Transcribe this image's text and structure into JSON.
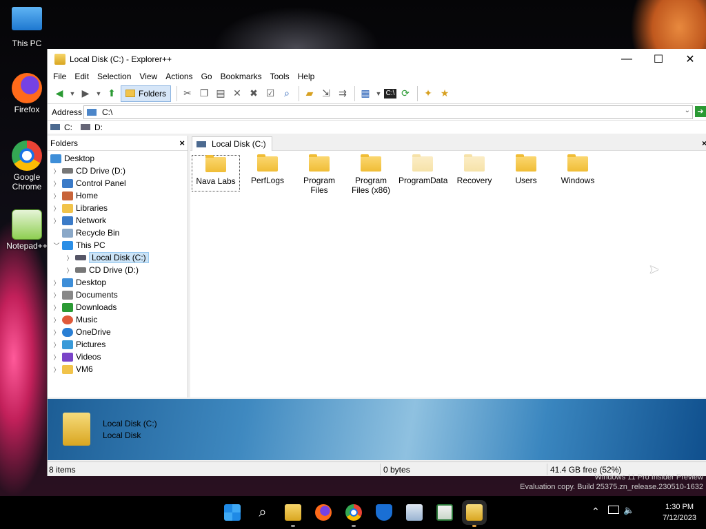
{
  "desktop": {
    "icons": [
      {
        "label": "This PC",
        "color": "#1e90e0"
      },
      {
        "label": "Firefox",
        "color": "#ff6a1a"
      },
      {
        "label": "Google Chrome",
        "color": "#2f9a3c"
      },
      {
        "label": "Notepad++",
        "color": "#7bc043"
      }
    ]
  },
  "window": {
    "title": "Local Disk (C:) - Explorer++",
    "minimize_label": "—",
    "maximize_label": "☐",
    "close_label": "✕"
  },
  "menu": [
    "File",
    "Edit",
    "Selection",
    "View",
    "Actions",
    "Go",
    "Bookmarks",
    "Tools",
    "Help"
  ],
  "toolbar": {
    "folders_label": "Folders"
  },
  "address": {
    "label": "Address",
    "value": "C:\\",
    "go_label": "➔"
  },
  "drives": [
    {
      "label": "C:"
    },
    {
      "label": "D:"
    }
  ],
  "tree": {
    "header": "Folders",
    "close_label": "×",
    "items": [
      {
        "label": "Desktop",
        "color": "#3e8ed8"
      },
      {
        "label": "CD Drive (D:)",
        "color": "#777"
      },
      {
        "label": "Control Panel",
        "color": "#3b7bc8"
      },
      {
        "label": "Home",
        "color": "#c8643a"
      },
      {
        "label": "Libraries",
        "color": "#f1c34a"
      },
      {
        "label": "Network",
        "color": "#3b7bc8"
      },
      {
        "label": "Recycle Bin",
        "color": "#8aa8c8"
      },
      {
        "label": "This PC",
        "color": "#2a8ee6"
      },
      {
        "label": "Local Disk (C:)",
        "color": "#556"
      },
      {
        "label": "CD Drive (D:)",
        "color": "#777"
      },
      {
        "label": "Desktop",
        "color": "#3e8ed8"
      },
      {
        "label": "Documents",
        "color": "#888"
      },
      {
        "label": "Downloads",
        "color": "#2b9a34"
      },
      {
        "label": "Music",
        "color": "#e05a3a"
      },
      {
        "label": "OneDrive",
        "color": "#2a7fd4"
      },
      {
        "label": "Pictures",
        "color": "#3a9ad8"
      },
      {
        "label": "Videos",
        "color": "#7a44c8"
      },
      {
        "label": "VM6",
        "color": "#f1c34a"
      }
    ]
  },
  "tab": {
    "label": "Local Disk (C:)",
    "close_label": "×"
  },
  "files": [
    {
      "name": "Nava Labs"
    },
    {
      "name": "PerfLogs"
    },
    {
      "name": "Program Files"
    },
    {
      "name": "Program Files (x86)"
    },
    {
      "name": "ProgramData"
    },
    {
      "name": "Recovery"
    },
    {
      "name": "Users"
    },
    {
      "name": "Windows"
    }
  ],
  "info": {
    "line1": "Local Disk (C:)",
    "line2": "Local Disk"
  },
  "status": {
    "items": "8 items",
    "size": "0 bytes",
    "free": "41.4 GB free (52%)"
  },
  "watermark": {
    "line1": "Windows 11 Pro Insider Preview",
    "line2": "Evaluation copy. Build 25375.zn_release.230510-1632"
  },
  "clock": {
    "time": "1:30 PM",
    "date": "7/12/2023"
  }
}
